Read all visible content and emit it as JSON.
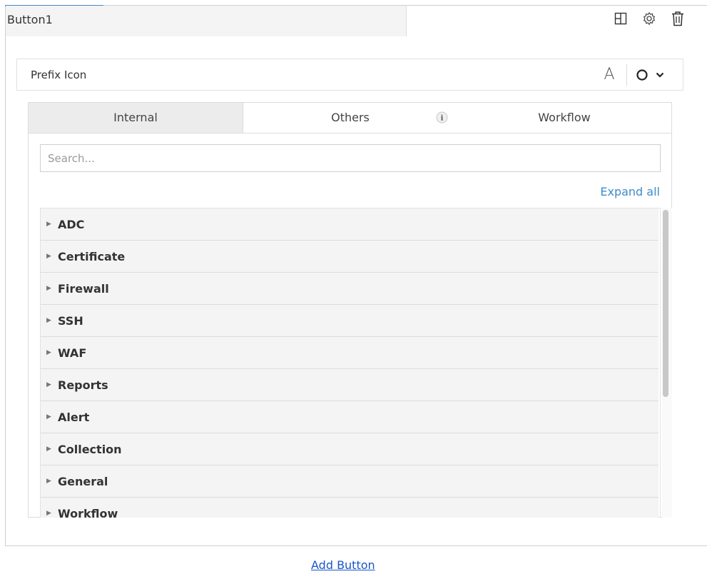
{
  "button_name": "Button1",
  "toolbar": {
    "icons": [
      "layout-icon",
      "gear-icon",
      "trash-icon"
    ]
  },
  "prefix": {
    "label": "Prefix Icon",
    "text_icon": "A",
    "selected_icon": "circle-icon"
  },
  "tabs": [
    {
      "label": "Internal",
      "active": true
    },
    {
      "label": "Others",
      "active": false
    },
    {
      "label": "Workflow",
      "active": false
    }
  ],
  "info_glyph": "i",
  "search": {
    "placeholder": "Search...",
    "value": ""
  },
  "expand_all": "Expand all",
  "categories": [
    "ADC",
    "Certificate",
    "Firewall",
    "SSH",
    "WAF",
    "Reports",
    "Alert",
    "Collection",
    "General",
    "Workflow"
  ],
  "add_button": "Add Button",
  "colors": {
    "accent": "#4a86c7",
    "link": "#3c8dc8",
    "add_link": "#1a56c8"
  }
}
